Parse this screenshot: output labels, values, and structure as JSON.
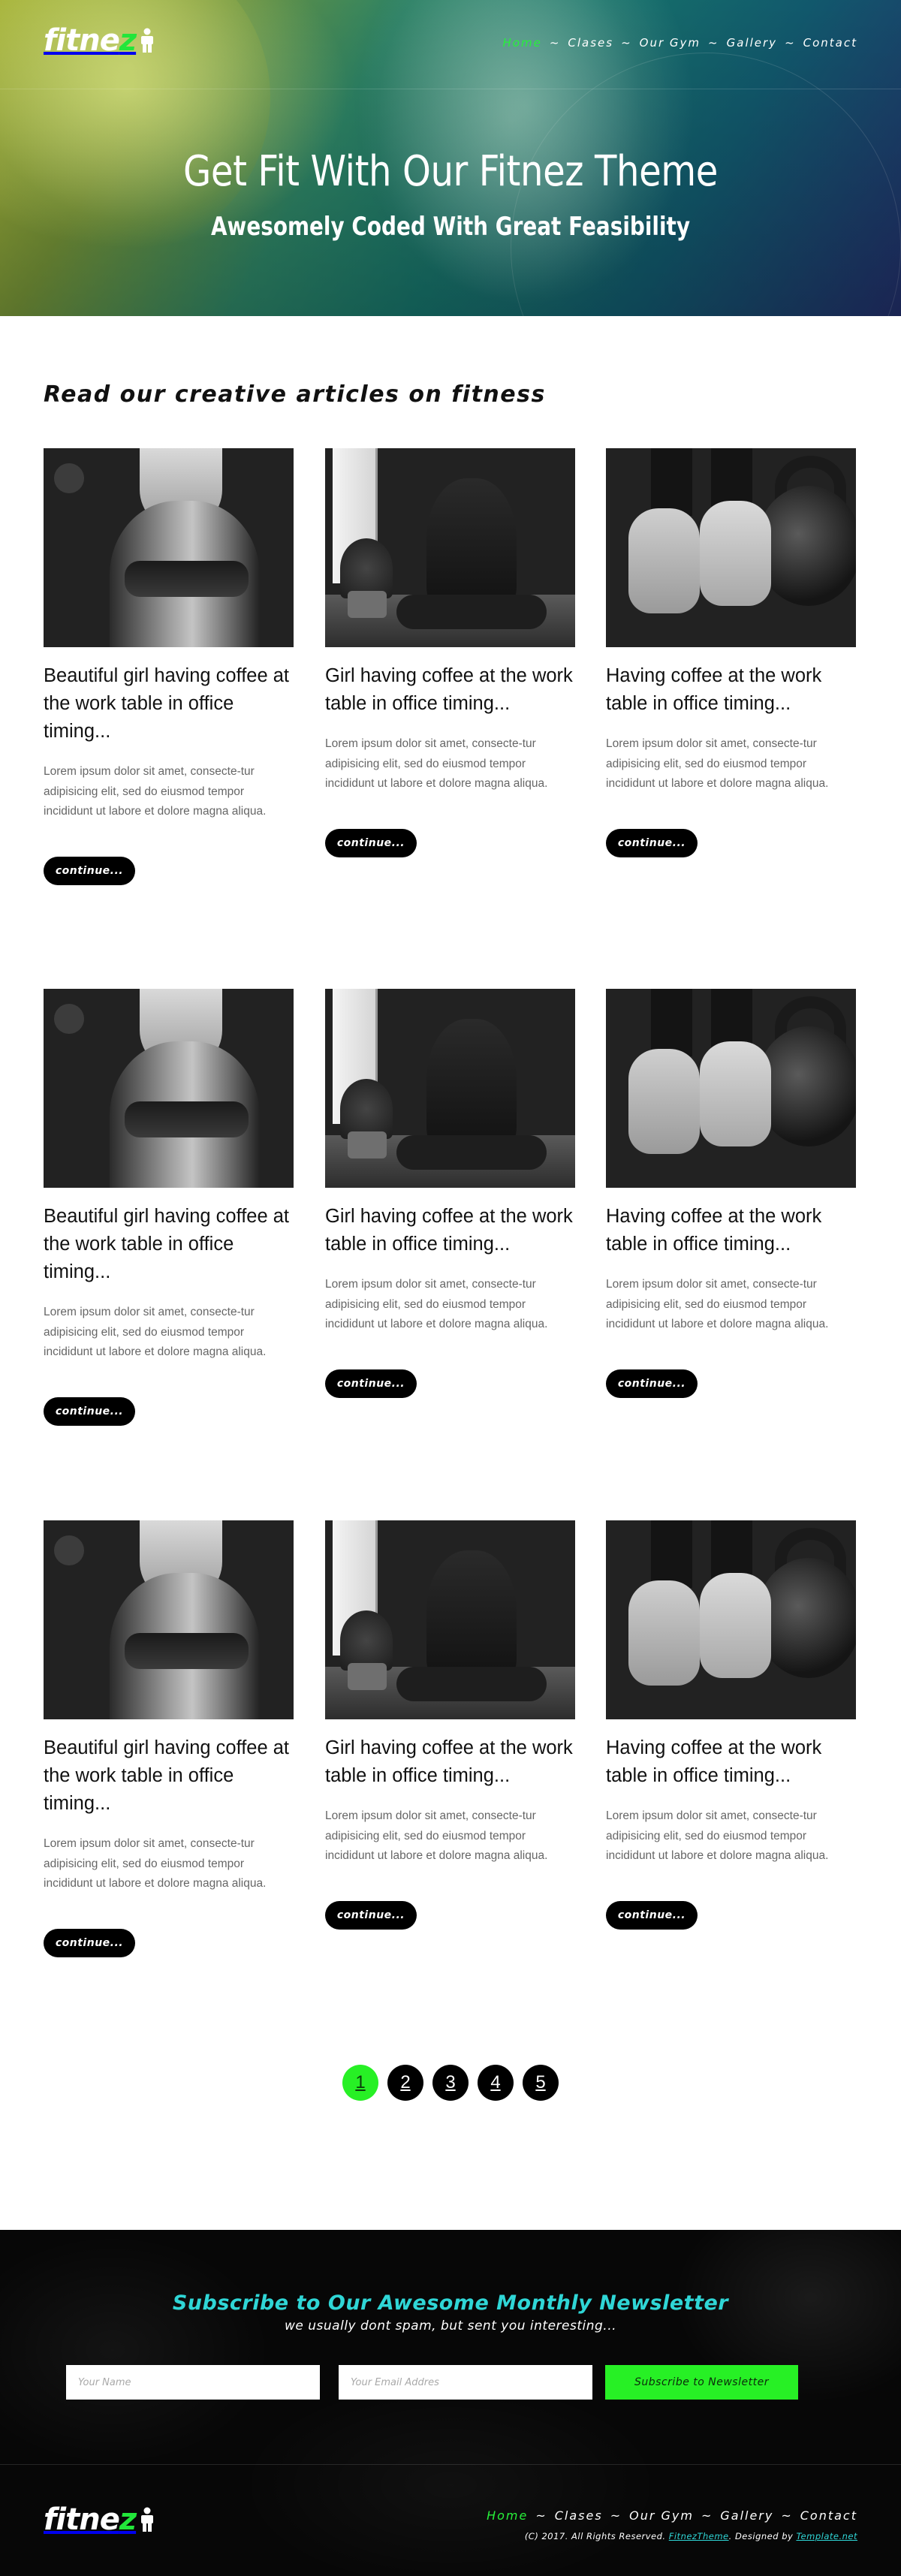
{
  "brand": {
    "name_main": "fitne",
    "name_accent": "z"
  },
  "nav": {
    "items": [
      {
        "label": "Home"
      },
      {
        "label": "Clases"
      },
      {
        "label": "Our Gym"
      },
      {
        "label": "Gallery"
      },
      {
        "label": "Contact"
      }
    ],
    "separator": "~"
  },
  "hero": {
    "title": "Get Fit With Our Fitnez Theme",
    "subtitle": "Awesomely Coded With Great Feasibility"
  },
  "articles": {
    "heading": "Read our creative articles on fitness",
    "button_label": "continue...",
    "rows": [
      [
        {
          "title": "Beautiful girl having coffee at the work table in office timing...",
          "excerpt": "Lorem ipsum dolor sit amet, consecte-tur adipisicing elit, sed do eiusmod tempor incididunt ut labore et dolore magna aliqua.",
          "image": "woman-back-photo"
        },
        {
          "title": "Girl having coffee at the work table in office timing...",
          "excerpt": "Lorem ipsum dolor sit amet, consecte-tur adipisicing elit, sed do eiusmod tempor incididunt ut labore et dolore magna aliqua.",
          "image": "yoga-photo"
        },
        {
          "title": "Having coffee at the work table in office timing...",
          "excerpt": "Lorem ipsum dolor sit amet, consecte-tur adipisicing elit, sed do eiusmod tempor incididunt ut labore et dolore magna aliqua.",
          "image": "shoes-kettlebell-photo"
        }
      ],
      [
        {
          "title": "Beautiful girl having coffee at the work table in office timing...",
          "excerpt": "Lorem ipsum dolor sit amet, consecte-tur adipisicing elit, sed do eiusmod tempor incididunt ut labore et dolore magna aliqua.",
          "image": "woman-back-photo"
        },
        {
          "title": "Girl having coffee at the work table in office timing...",
          "excerpt": "Lorem ipsum dolor sit amet, consecte-tur adipisicing elit, sed do eiusmod tempor incididunt ut labore et dolore magna aliqua.",
          "image": "yoga-photo"
        },
        {
          "title": "Having coffee at the work table in office timing...",
          "excerpt": "Lorem ipsum dolor sit amet, consecte-tur adipisicing elit, sed do eiusmod tempor incididunt ut labore et dolore magna aliqua.",
          "image": "shoes-kettlebell-photo"
        }
      ],
      [
        {
          "title": "Beautiful girl having coffee at the work table in office timing...",
          "excerpt": "Lorem ipsum dolor sit amet, consecte-tur adipisicing elit, sed do eiusmod tempor incididunt ut labore et dolore magna aliqua.",
          "image": "woman-back-photo"
        },
        {
          "title": "Girl having coffee at the work table in office timing...",
          "excerpt": "Lorem ipsum dolor sit amet, consecte-tur adipisicing elit, sed do eiusmod tempor incididunt ut labore et dolore magna aliqua.",
          "image": "yoga-photo"
        },
        {
          "title": "Having coffee at the work table in office timing...",
          "excerpt": "Lorem ipsum dolor sit amet, consecte-tur adipisicing elit, sed do eiusmod tempor incididunt ut labore et dolore magna aliqua.",
          "image": "shoes-kettlebell-photo"
        }
      ]
    ]
  },
  "pagination": {
    "pages": [
      "1",
      "2",
      "3",
      "4",
      "5"
    ],
    "current": "1"
  },
  "newsletter": {
    "title": "Subscribe to Our Awesome Monthly Newsletter",
    "subtitle": "we usually dont spam, but sent you interesting...",
    "name_placeholder": "Your Name",
    "email_placeholder": "Your Email Addres",
    "button_label": "Subscribe to Newsletter"
  },
  "footer": {
    "copyright_prefix": "(C) 2017. All Rights Reserved.",
    "brand_link": "FitnezTheme",
    "designed_by": ". Designed by",
    "designer_link": "Template.net"
  },
  "colors": {
    "accent_green": "#27f025",
    "accent_cyan": "#2fd6d6",
    "footer_bg": "#070707"
  }
}
